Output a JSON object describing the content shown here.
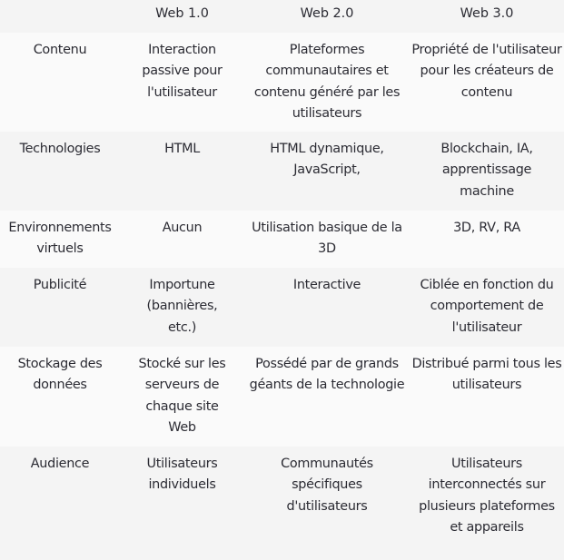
{
  "table": {
    "headers": [
      "",
      "Web 1.0",
      "Web 2.0",
      "Web 3.0"
    ],
    "rows": [
      {
        "label": "Contenu",
        "web1": "Interaction passive pour l'utilisateur",
        "web2": "Plateformes communautaires et contenu généré par les utilisateurs",
        "web3": "Propriété de l'utilisateur pour les créateurs de contenu"
      },
      {
        "label": "Technologies",
        "web1": "HTML",
        "web2": "HTML dynamique, JavaScript,",
        "web3": "Blockchain, IA, apprentissage machine"
      },
      {
        "label": "Environnements virtuels",
        "web1": "Aucun",
        "web2": "Utilisation basique de la 3D",
        "web3": "3D, RV, RA"
      },
      {
        "label": "Publicité",
        "web1": "Importune (bannières, etc.)",
        "web2": "Interactive",
        "web3": "Ciblée en fonction du comportement de l'utilisateur"
      },
      {
        "label": "Stockage des données",
        "web1": "Stocké sur les serveurs de chaque site Web",
        "web2": "Possédé par de grands géants de la technologie",
        "web3": "Distribué parmi tous les utilisateurs"
      },
      {
        "label": "Audience",
        "web1": "Utilisateurs individuels",
        "web2": "Communautés spécifiques d'utilisateurs",
        "web3": "Utilisateurs interconnectés sur plusieurs plateformes et appareils"
      }
    ]
  },
  "colors": {
    "text": "#2b2b33",
    "row_light": "#fafafa",
    "row_dark": "#f4f4f4"
  }
}
